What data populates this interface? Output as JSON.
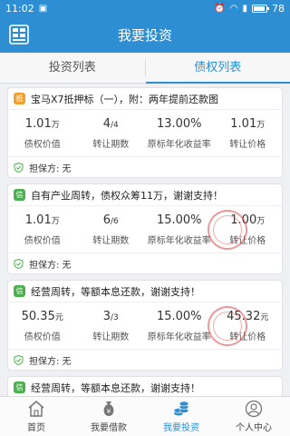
{
  "status_bar": {
    "time": "11:02",
    "battery": "78"
  },
  "header": {
    "title": "我要投资"
  },
  "tabs": [
    {
      "label": "投资列表",
      "active": false
    },
    {
      "label": "债权列表",
      "active": true
    }
  ],
  "cards": [
    {
      "tag": "抵",
      "title": "宝马X7抵押标（一），附：两年提前还款图",
      "stats": [
        {
          "value": "1.01",
          "unit": "万",
          "label": "债权价值"
        },
        {
          "value": "4",
          "unit": "/4",
          "label": "转让期数"
        },
        {
          "value": "13.00%",
          "unit": "",
          "label": "原标年化收益率"
        },
        {
          "value": "1.01",
          "unit": "万",
          "label": "转让价格"
        }
      ],
      "guarantee": "担保方: 无"
    },
    {
      "tag": "信",
      "title": "自有产业周转，债权众筹11万，谢谢支持！",
      "stats": [
        {
          "value": "1.01",
          "unit": "万",
          "label": "债权价值"
        },
        {
          "value": "6",
          "unit": "/6",
          "label": "转让期数"
        },
        {
          "value": "15.00%",
          "unit": "",
          "label": "原标年化收益率"
        },
        {
          "value": "1.00",
          "unit": "万",
          "label": "转让价格"
        }
      ],
      "guarantee": "担保方: 无"
    },
    {
      "tag": "信",
      "title": "经营周转，等额本息还款，谢谢支持！",
      "stats": [
        {
          "value": "50.35",
          "unit": "元",
          "label": "债权价值"
        },
        {
          "value": "3",
          "unit": "/3",
          "label": "转让期数"
        },
        {
          "value": "15.00%",
          "unit": "",
          "label": "原标年化收益率"
        },
        {
          "value": "45.32",
          "unit": "元",
          "label": "转让价格"
        }
      ],
      "guarantee": "担保方: 无"
    },
    {
      "tag": "信",
      "title": "经营周转，等额本息还款，谢谢支持！"
    }
  ],
  "bottom_nav": [
    {
      "label": "首页",
      "icon": "home-icon",
      "active": false
    },
    {
      "label": "我要借款",
      "icon": "money-bag-icon",
      "active": false
    },
    {
      "label": "我要投资",
      "icon": "coins-icon",
      "active": true
    },
    {
      "label": "个人中心",
      "icon": "person-icon",
      "active": false
    }
  ],
  "colors": {
    "primary": "#2e8ed3",
    "tag_mortgage": "#f0a030",
    "tag_credit": "#4cb050",
    "stamp": "#dc4646"
  }
}
